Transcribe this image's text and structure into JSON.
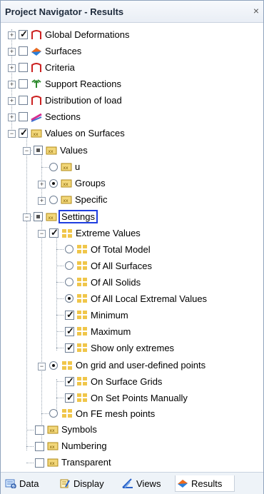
{
  "window": {
    "title": "Project Navigator - Results",
    "close": "×"
  },
  "tree": {
    "global_deformations": "Global Deformations",
    "surfaces": "Surfaces",
    "criteria": "Criteria",
    "support_reactions": "Support Reactions",
    "distribution_of_load": "Distribution of load",
    "sections": "Sections",
    "values_on_surfaces": "Values on Surfaces",
    "values": "Values",
    "u": "u",
    "groups": "Groups",
    "specific": "Specific",
    "settings": "Settings",
    "extreme_values": "Extreme Values",
    "of_total_model": "Of Total Model",
    "of_all_surfaces": "Of All Surfaces",
    "of_all_solids": "Of All Solids",
    "of_all_local_extremal_values": "Of All Local Extremal Values",
    "minimum": "Minimum",
    "maximum": "Maximum",
    "show_only_extremes": "Show only extremes",
    "on_grid_and_user_defined_points": "On grid and user-defined points",
    "on_surface_grids": "On Surface Grids",
    "on_set_points_manually": "On Set Points Manually",
    "on_fe_mesh_points": "On FE mesh points",
    "symbols": "Symbols",
    "numbering": "Numbering",
    "transparent": "Transparent"
  },
  "tabs": {
    "data": "Data",
    "display": "Display",
    "views": "Views",
    "results": "Results"
  },
  "colors": {
    "selection_border": "#1f3fe0",
    "xx_icon": "#d9b437",
    "results_icon": "#1d7bd6"
  }
}
